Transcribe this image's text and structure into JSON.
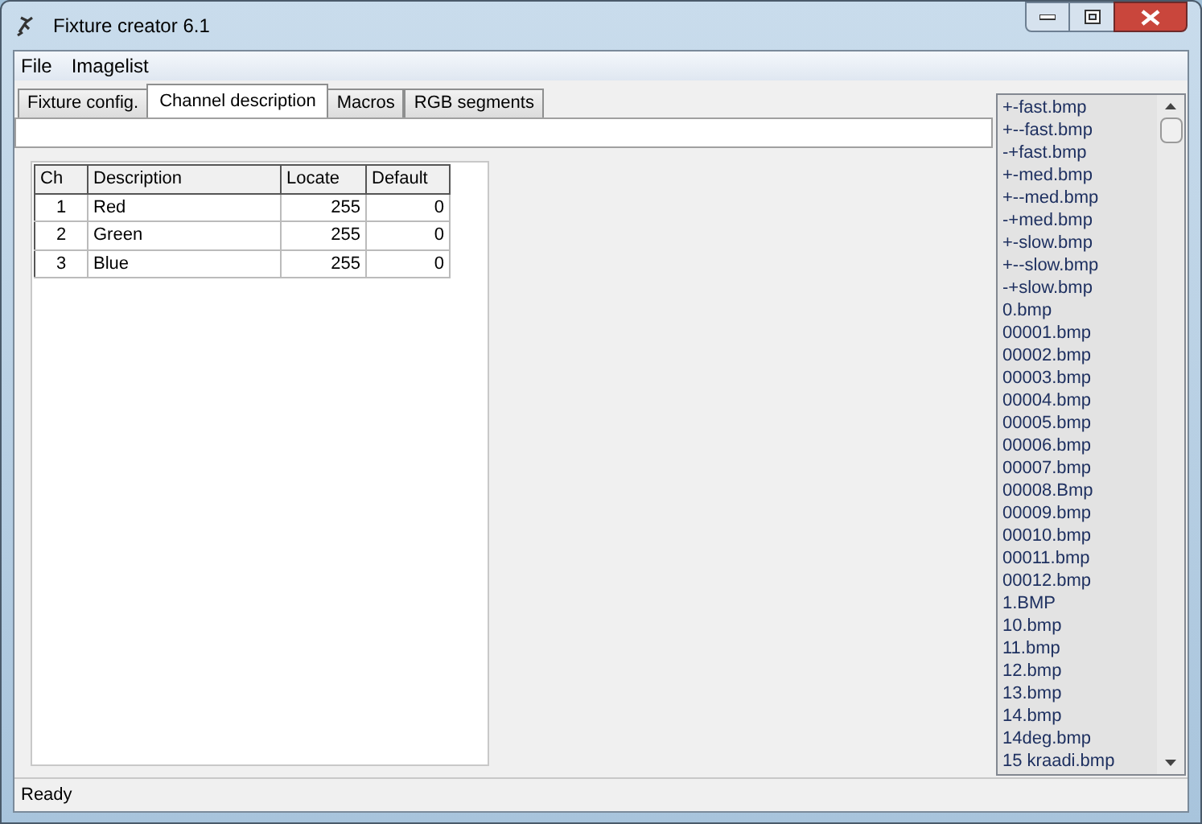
{
  "window": {
    "title": "Fixture creator 6.1"
  },
  "menu": [
    "File",
    "Imagelist"
  ],
  "tabs": [
    {
      "label": "Fixture config.",
      "selected": false
    },
    {
      "label": "Channel description",
      "selected": true
    },
    {
      "label": "Macros",
      "selected": false
    },
    {
      "label": "RGB segments",
      "selected": false
    }
  ],
  "table": {
    "columns": [
      "Ch",
      "Description",
      "Locate",
      "Default"
    ],
    "rows": [
      [
        "1",
        "Red",
        "255",
        "0"
      ],
      [
        "2",
        "Green",
        "255",
        "0"
      ],
      [
        "3",
        "Blue",
        "255",
        "0"
      ]
    ]
  },
  "imagelist": [
    "+-fast.bmp",
    "+--fast.bmp",
    "-+fast.bmp",
    "+-med.bmp",
    "+--med.bmp",
    "-+med.bmp",
    "+-slow.bmp",
    "+--slow.bmp",
    "-+slow.bmp",
    "0.bmp",
    "00001.bmp",
    "00002.bmp",
    "00003.bmp",
    "00004.bmp",
    "00005.bmp",
    "00006.bmp",
    "00007.bmp",
    "00008.Bmp",
    "00009.bmp",
    "00010.bmp",
    "00011.bmp",
    "00012.bmp",
    "1.BMP",
    "10.bmp",
    "11.bmp",
    "12.bmp",
    "13.bmp",
    "14.bmp",
    "14deg.bmp",
    "15 kraadi.bmp"
  ],
  "status_bar": "Ready"
}
